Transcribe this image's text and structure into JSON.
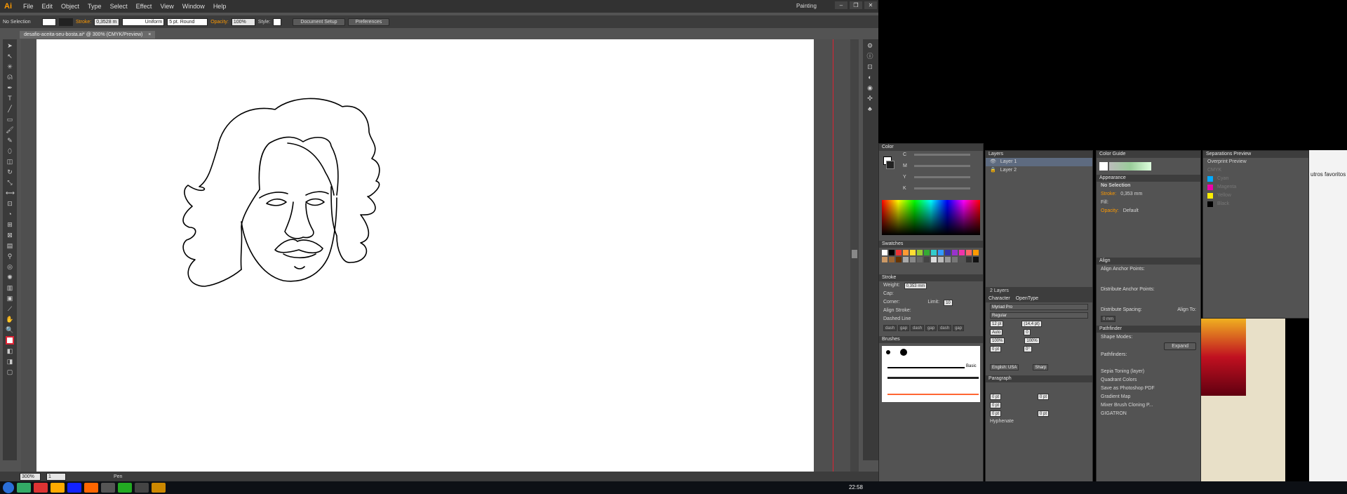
{
  "app": {
    "logo": "Ai",
    "workspace": "Painting"
  },
  "menu": [
    "File",
    "Edit",
    "Object",
    "Type",
    "Select",
    "Effect",
    "View",
    "Window",
    "Help"
  ],
  "control_bar": {
    "selection": "No Selection",
    "stroke_label": "Stroke:",
    "stroke_value": "0,3528 m",
    "profile": "Uniform",
    "brush": "5 pt. Round",
    "opacity_label": "Opacity:",
    "opacity_value": "100%",
    "style_label": "Style:",
    "doc_setup": "Document Setup",
    "preferences": "Preferences"
  },
  "document_tab": {
    "title": "desafio-aceita-seu-bosta.ai* @ 300% (CMYK/Preview)",
    "close": "×"
  },
  "status": {
    "zoom": "300%",
    "page": "1",
    "tool": "Pen"
  },
  "panels": {
    "color": {
      "title": "Color",
      "channels": [
        "C",
        "M",
        "Y",
        "K"
      ],
      "pct": "%"
    },
    "swatches": {
      "title": "Swatches"
    },
    "stroke": {
      "title": "Stroke",
      "weight_label": "Weight:",
      "weight": "0,353 mm",
      "cap_label": "Cap:",
      "corner_label": "Corner:",
      "limit_label": "Limit:",
      "limit": "10",
      "align_label": "Align Stroke:",
      "dashed": "Dashed Line",
      "dash_labels": [
        "dash",
        "gap",
        "dash",
        "gap",
        "dash",
        "gap"
      ]
    },
    "brushes": {
      "title": "Brushes",
      "basic": "Basic"
    },
    "layers": {
      "title": "Layers",
      "items": [
        "Layer 1",
        "Layer 2"
      ],
      "count": "2 Layers"
    },
    "character": {
      "tabs": [
        "Character",
        "OpenType"
      ],
      "font": "Myriad Pro",
      "style": "Regular",
      "size": "12 pt",
      "leading": "(14,4 pt)",
      "kern": "Auto",
      "track": "0",
      "vscale": "100%",
      "hscale": "100%",
      "baseline": "0 pt",
      "rotate": "0°",
      "language": "English: USA",
      "aa": "Sharp"
    },
    "paragraph": {
      "title": "Paragraph",
      "vals": [
        "0 pt",
        "0 pt",
        "0 pt",
        "0 pt",
        "0 pt"
      ],
      "hyphenate": "Hyphenate"
    },
    "color_guide": {
      "title": "Color Guide"
    },
    "appearance": {
      "title": "Appearance",
      "selection": "No Selection",
      "stroke_label": "Stroke:",
      "stroke_val": "0,353 mm",
      "fill_label": "Fill:",
      "opacity_label": "Opacity:",
      "opacity_val": "Default"
    },
    "align": {
      "title": "Align",
      "anchor": "Align Anchor Points:",
      "distribute": "Distribute Anchor Points:",
      "spacing": "Distribute Spacing:",
      "align_to": "Align To:",
      "spacing_val": "0 mm"
    },
    "pathfinder": {
      "title": "Pathfinder",
      "shape_modes": "Shape Modes:",
      "expand": "Expand",
      "pathfinders": "Pathfinders:"
    },
    "actions": [
      "Sepia Toning (layer)",
      "Quadrant Colors",
      "Save as Photoshop PDF",
      "Gradient Map",
      "Mixer Brush Cloning P...",
      "GIGATRON"
    ],
    "separations": {
      "title": "Separations Preview",
      "overprint": "Overprint Preview",
      "inks": [
        "CMYK",
        "Cyan",
        "Magenta",
        "Yellow",
        "Black"
      ]
    },
    "browser": {
      "favorites": "utros favoritos"
    }
  },
  "clock": "22:58",
  "colors": {
    "accent": "#ff9a00",
    "guide": "#dd2233"
  }
}
